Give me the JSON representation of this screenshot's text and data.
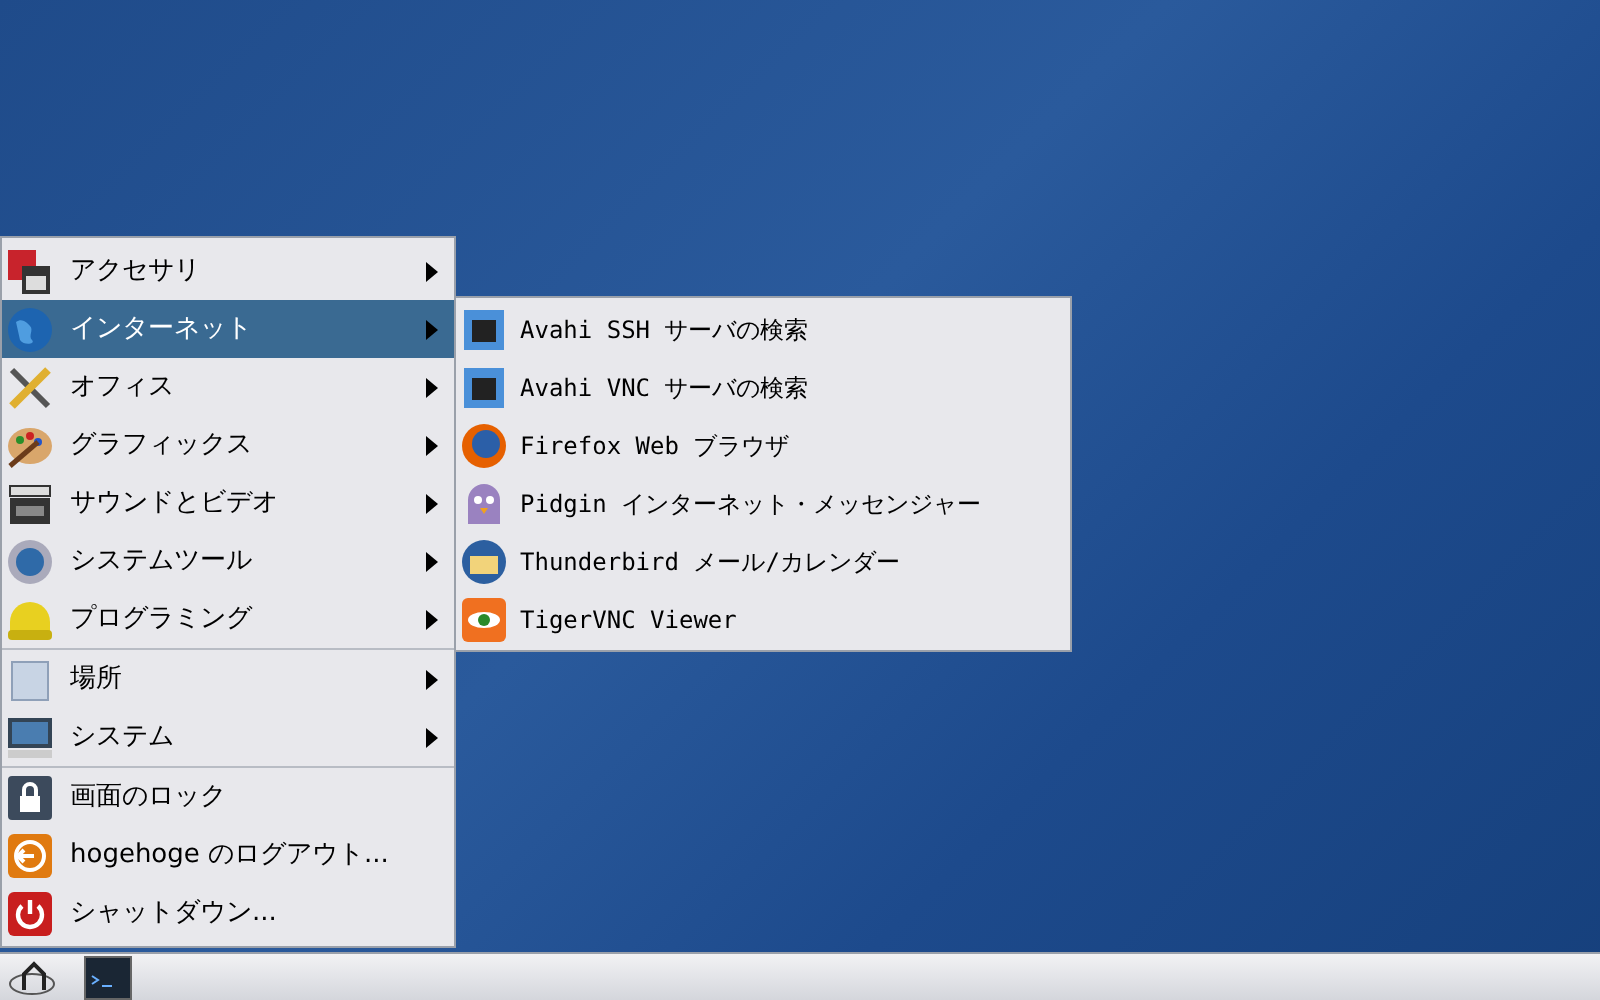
{
  "main_menu": {
    "sections": [
      {
        "items": [
          {
            "label": "アクセサリ",
            "has_submenu": true,
            "selected": false
          },
          {
            "label": "インターネット",
            "has_submenu": true,
            "selected": true
          },
          {
            "label": "オフィス",
            "has_submenu": true,
            "selected": false
          },
          {
            "label": "グラフィックス",
            "has_submenu": true,
            "selected": false
          },
          {
            "label": "サウンドとビデオ",
            "has_submenu": true,
            "selected": false
          },
          {
            "label": "システムツール",
            "has_submenu": true,
            "selected": false
          },
          {
            "label": "プログラミング",
            "has_submenu": true,
            "selected": false
          }
        ]
      },
      {
        "items": [
          {
            "label": "場所",
            "has_submenu": true,
            "selected": false
          },
          {
            "label": "システム",
            "has_submenu": true,
            "selected": false
          }
        ]
      },
      {
        "items": [
          {
            "label": "画面のロック",
            "has_submenu": false,
            "selected": false
          },
          {
            "label": "hogehoge のログアウト...",
            "has_submenu": false,
            "selected": false
          },
          {
            "label": "シャットダウン...",
            "has_submenu": false,
            "selected": false
          }
        ]
      }
    ]
  },
  "submenu": {
    "items": [
      {
        "label": "Avahi SSH サーバの検索"
      },
      {
        "label": "Avahi VNC サーバの検索"
      },
      {
        "label": "Firefox Web ブラウザ"
      },
      {
        "label": "Pidgin インターネット・メッセンジャー"
      },
      {
        "label": "Thunderbird メール/カレンダー"
      },
      {
        "label": "TigerVNC Viewer"
      }
    ]
  }
}
